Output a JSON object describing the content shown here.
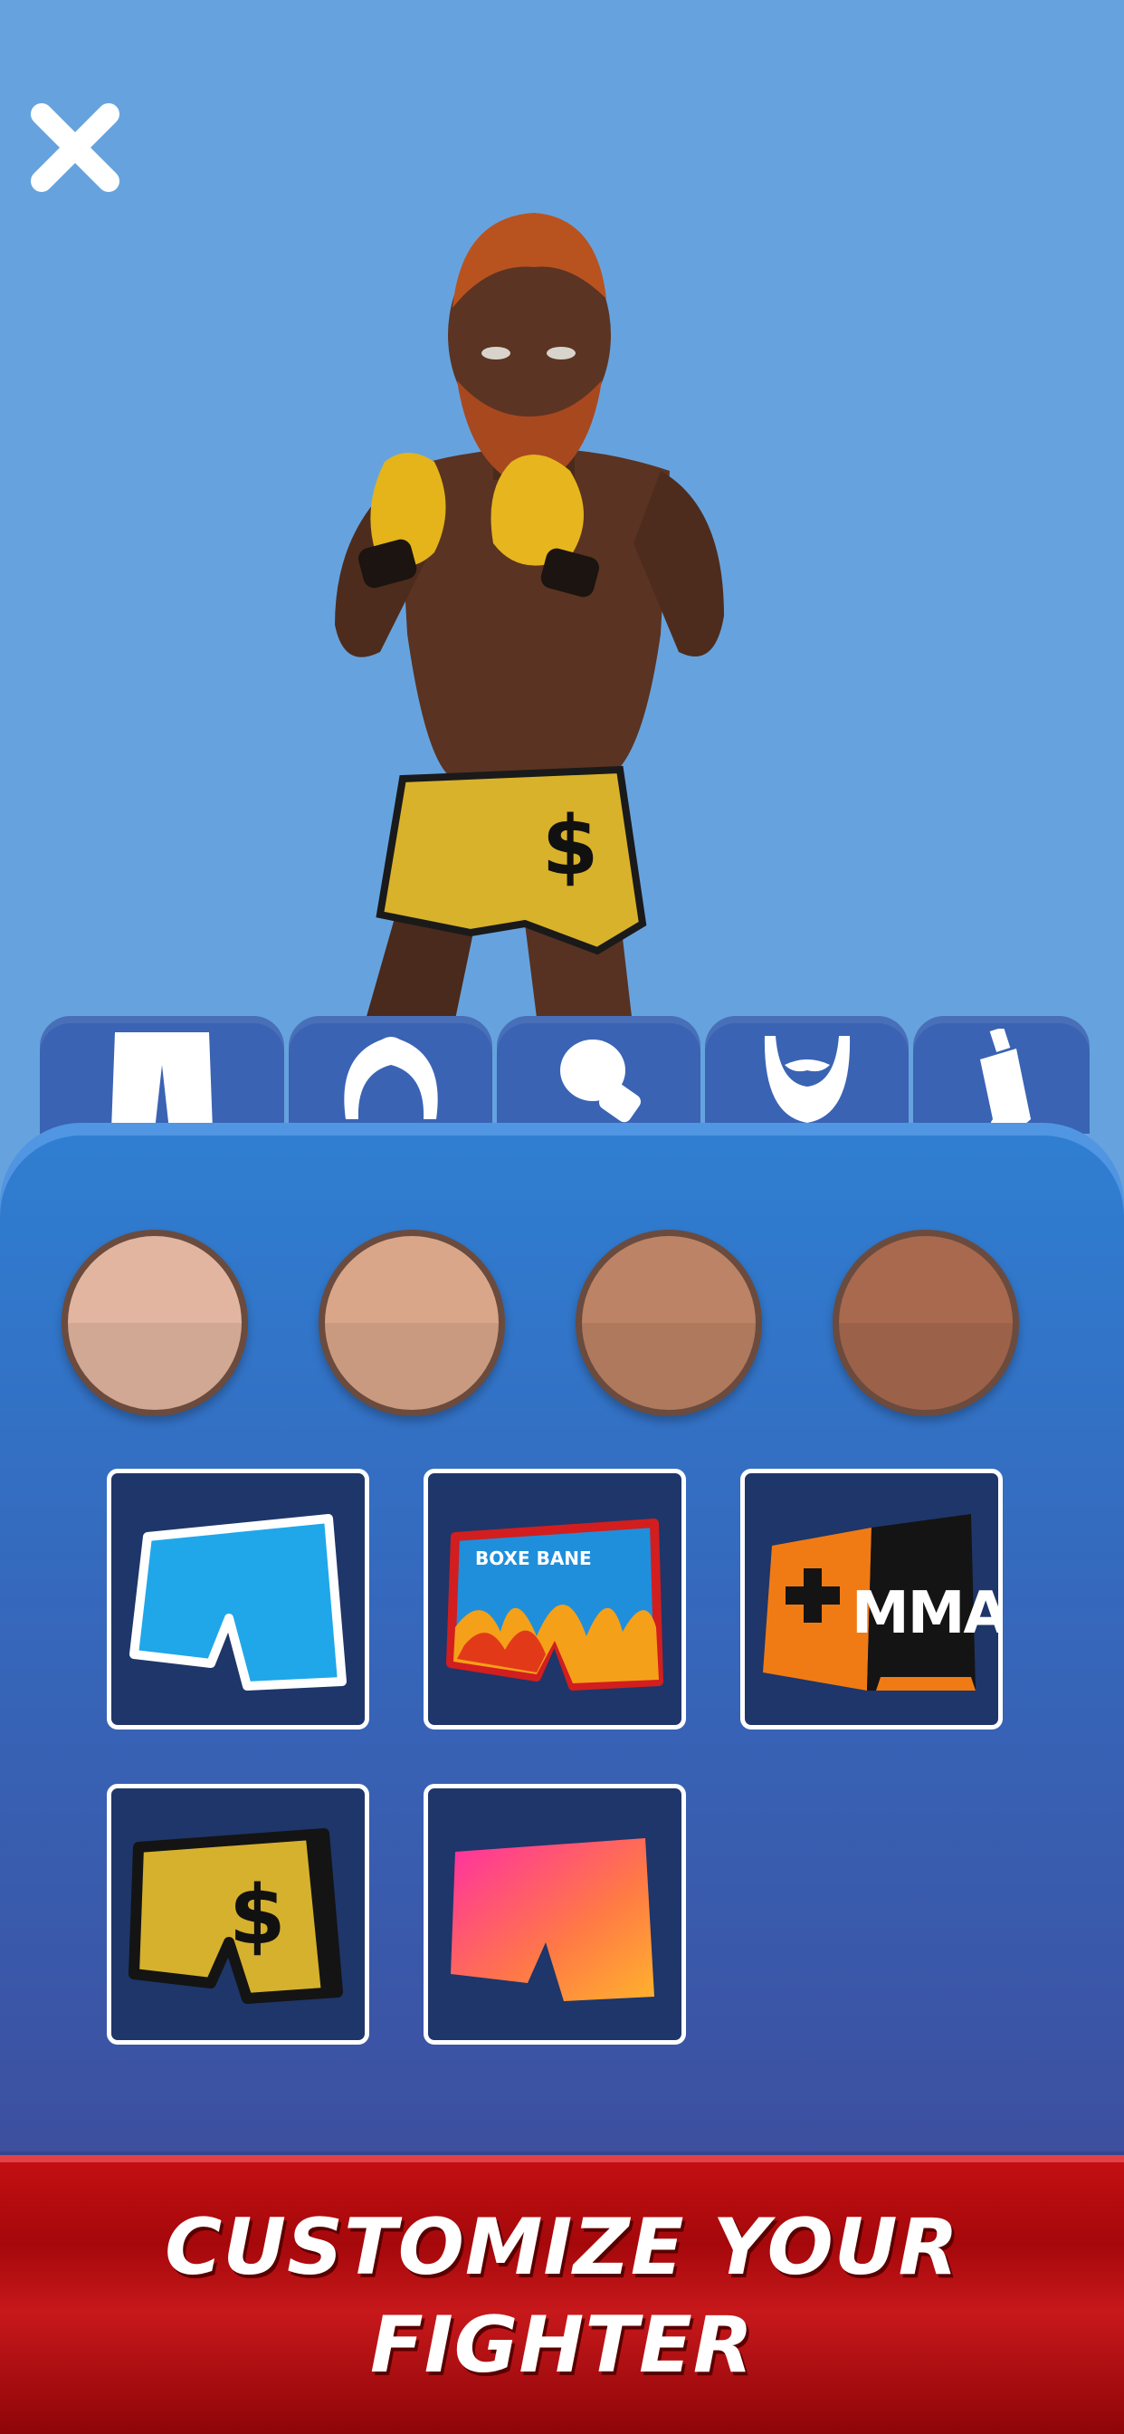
{
  "banner": {
    "line1": "CUSTOMIZE YOUR",
    "line2": "FIGHTER"
  },
  "tabs": [
    {
      "icon": "shorts-icon",
      "selected": true
    },
    {
      "icon": "hair-icon",
      "selected": false
    },
    {
      "icon": "glove-icon",
      "selected": false
    },
    {
      "icon": "beard-icon",
      "selected": false
    },
    {
      "icon": "bottle-icon",
      "selected": false
    }
  ],
  "skin_tones": [
    "#e1b59f",
    "#d9a689",
    "#bd8366",
    "#a8694f"
  ],
  "shorts": [
    {
      "name": "blue-white-shorts"
    },
    {
      "name": "flame-shorts",
      "label": "BOXE BANE"
    },
    {
      "name": "orange-black-mma-shorts",
      "label": "MMA"
    },
    {
      "name": "gold-dollar-shorts",
      "label": "$"
    },
    {
      "name": "pink-orange-shorts"
    }
  ],
  "fighter": {
    "shorts_label": "$"
  },
  "colors": {
    "background": "#66a3de",
    "tab": "#3a63b4",
    "banner": "#b80c10"
  }
}
